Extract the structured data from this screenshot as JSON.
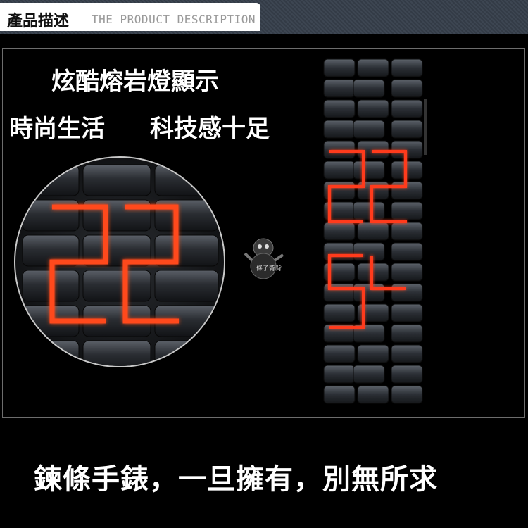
{
  "header": {
    "title_cn": "產品描述",
    "title_en": "THE PRODUCT DESCRIPTION"
  },
  "taglines": {
    "line1": "炫酷熔岩燈顯示",
    "line2a": "時尚生活",
    "line2b": "科技感十足"
  },
  "slogan": "鍊條手錶，一旦擁有，別無所求",
  "watermark": "條子背背",
  "display_digits": [
    "2",
    "2",
    "5",
    "4"
  ],
  "magnified_digits": [
    "2",
    "2"
  ],
  "colors": {
    "led": "#ff3a1a",
    "metal": "#4a4f56",
    "background": "#000000"
  }
}
